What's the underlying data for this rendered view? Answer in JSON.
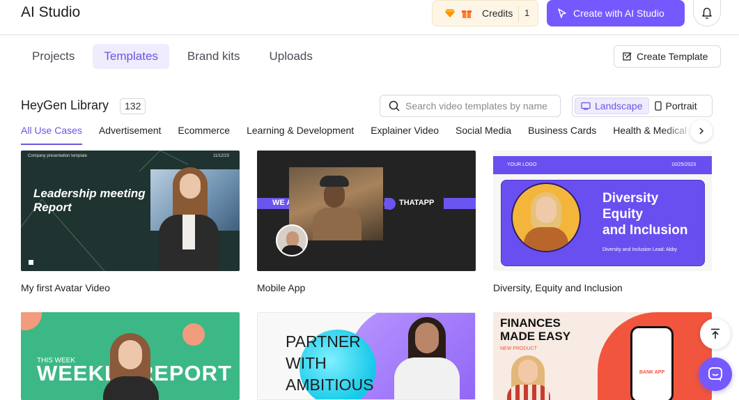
{
  "header": {
    "app_title": "AI Studio",
    "credits_label": "Credits",
    "credits_count": "1",
    "create_button": "Create with AI Studio",
    "accent_color": "#7559ff"
  },
  "tabs": [
    {
      "label": "Projects",
      "active": false
    },
    {
      "label": "Templates",
      "active": true
    },
    {
      "label": "Brand kits",
      "active": false
    },
    {
      "label": "Uploads",
      "active": false
    }
  ],
  "create_template_label": "Create Template",
  "library": {
    "title": "HeyGen Library",
    "count": "132",
    "search_placeholder": "Search video templates by name",
    "orientation": [
      {
        "label": "Landscape",
        "active": true
      },
      {
        "label": "Portrait",
        "active": false
      }
    ]
  },
  "categories": [
    {
      "label": "All Use Cases",
      "active": true
    },
    {
      "label": "Advertisement"
    },
    {
      "label": "Ecommerce"
    },
    {
      "label": "Learning & Development"
    },
    {
      "label": "Explainer Video"
    },
    {
      "label": "Social Media"
    },
    {
      "label": "Business Cards"
    },
    {
      "label": "Health & Medical"
    }
  ],
  "templates": [
    {
      "name": "My first Avatar Video",
      "thumb": {
        "small_left": "Company presentation template",
        "small_right": "11/12/23",
        "title_line1": "Leadership meeting",
        "title_line2": "Report"
      }
    },
    {
      "name": "Mobile App",
      "thumb": {
        "left_text": "WE ARE",
        "right_text": "THATAPP"
      }
    },
    {
      "name": "Diversity, Equity and Inclusion",
      "thumb": {
        "logo": "YOUR LOGO",
        "date": "10/25/2023",
        "line1": "Diversity",
        "line2": "Equity",
        "line3": "and Inclusion",
        "sub": "Diversity and Inclusion Lead: Abby"
      }
    },
    {
      "name": "",
      "thumb": {
        "small": "THIS WEEK",
        "big": "WEEKLY REPORT"
      }
    },
    {
      "name": "",
      "thumb": {
        "line1": "PARTNER",
        "line2": "WITH",
        "line3": "AMBITIOUS"
      }
    },
    {
      "name": "",
      "thumb": {
        "line1": "FINANCES",
        "line2": "MADE EASY",
        "small": "NEW PRODUCT",
        "phone_text": "BANK APP"
      }
    }
  ],
  "icons": [
    "diamond-icon",
    "gift-icon",
    "cursor-icon",
    "bell-icon",
    "edit-template-icon",
    "search-icon",
    "landscape-icon",
    "portrait-icon",
    "chevron-right-icon",
    "arrow-up-icon",
    "chat-icon"
  ]
}
